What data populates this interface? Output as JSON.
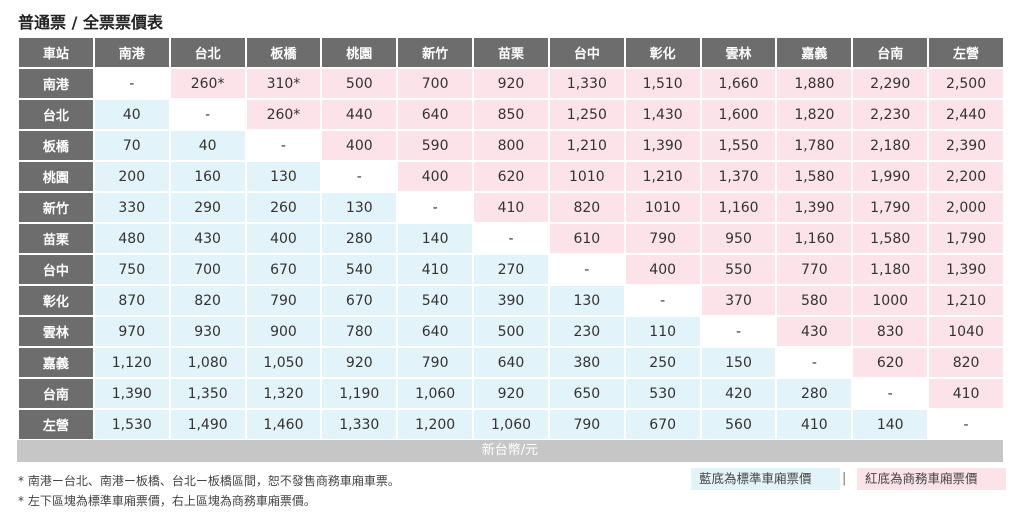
{
  "title": "普通票 / 全票票價表",
  "corner_label": "車站",
  "stations": [
    "南港",
    "台北",
    "板橋",
    "桃園",
    "新竹",
    "苗栗",
    "台中",
    "彰化",
    "雲林",
    "嘉義",
    "台南",
    "左營"
  ],
  "rows": [
    [
      "-",
      "260*",
      "310*",
      "500",
      "700",
      "920",
      "1,330",
      "1,510",
      "1,660",
      "1,880",
      "2,290",
      "2,500"
    ],
    [
      "40",
      "-",
      "260*",
      "440",
      "640",
      "850",
      "1,250",
      "1,430",
      "1,600",
      "1,820",
      "2,230",
      "2,440"
    ],
    [
      "70",
      "40",
      "-",
      "400",
      "590",
      "800",
      "1,210",
      "1,390",
      "1,550",
      "1,780",
      "2,180",
      "2,390"
    ],
    [
      "200",
      "160",
      "130",
      "-",
      "400",
      "620",
      "1010",
      "1,210",
      "1,370",
      "1,580",
      "1,990",
      "2,200"
    ],
    [
      "330",
      "290",
      "260",
      "130",
      "-",
      "410",
      "820",
      "1010",
      "1,160",
      "1,390",
      "1,790",
      "2,000"
    ],
    [
      "480",
      "430",
      "400",
      "280",
      "140",
      "-",
      "610",
      "790",
      "950",
      "1,160",
      "1,580",
      "1,790"
    ],
    [
      "750",
      "700",
      "670",
      "540",
      "410",
      "270",
      "-",
      "400",
      "550",
      "770",
      "1,180",
      "1,390"
    ],
    [
      "870",
      "820",
      "790",
      "670",
      "540",
      "390",
      "130",
      "-",
      "370",
      "580",
      "1000",
      "1,210"
    ],
    [
      "970",
      "930",
      "900",
      "780",
      "640",
      "500",
      "230",
      "110",
      "-",
      "430",
      "830",
      "1040"
    ],
    [
      "1,120",
      "1,080",
      "1,050",
      "920",
      "790",
      "640",
      "380",
      "250",
      "150",
      "-",
      "620",
      "820"
    ],
    [
      "1,390",
      "1,350",
      "1,320",
      "1,190",
      "1,060",
      "920",
      "650",
      "530",
      "420",
      "280",
      "-",
      "410"
    ],
    [
      "1,530",
      "1,490",
      "1,460",
      "1,330",
      "1,200",
      "1,060",
      "790",
      "670",
      "560",
      "410",
      "140",
      "-"
    ]
  ],
  "unit": "新台幣/元",
  "notes": [
    "* 南港ー台北、南港ー板橋、台北ー板橋區間，恕不發售商務車廂車票。",
    "* 左下區塊為標準車廂票價，右上區塊為商務車廂票價。"
  ],
  "legend": {
    "standard": "藍底為標準車廂票價",
    "separator": "|",
    "business": "紅底為商務車廂票價"
  },
  "colors": {
    "header_bg": "#6d6d6d",
    "standard_bg": "#e2f3f9",
    "business_bg": "#fbe3e9",
    "unit_bar_bg": "#c6c6c6"
  }
}
